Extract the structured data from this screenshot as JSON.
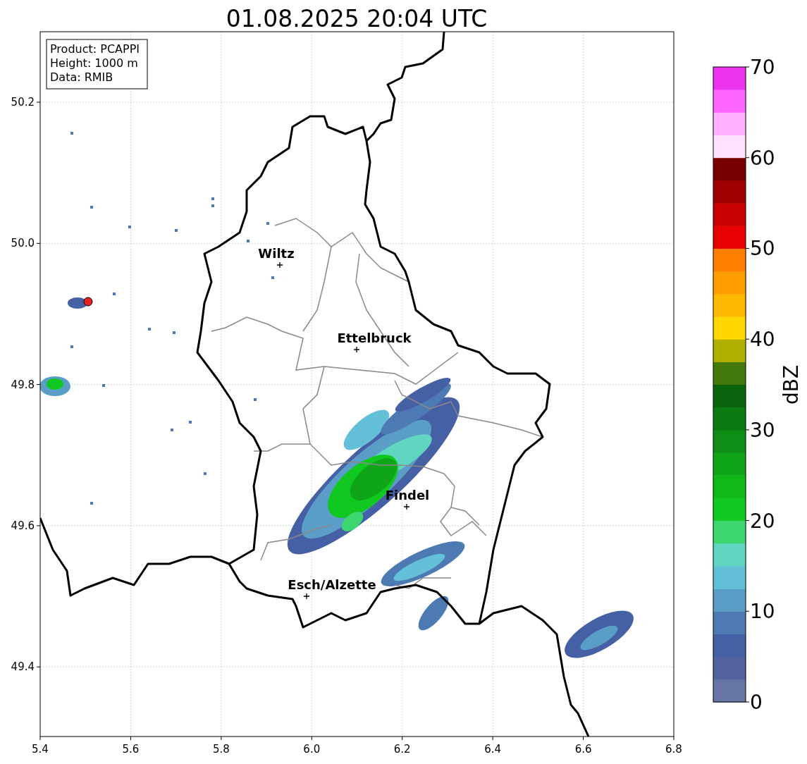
{
  "title": "01.08.2025 20:04 UTC",
  "info_box": [
    "Product: PCAPPI",
    "Height: 1000 m",
    "Data: RMIB"
  ],
  "cities": [
    {
      "name": "Wiltz"
    },
    {
      "name": "Ettelbruck"
    },
    {
      "name": "Findel"
    },
    {
      "name": "Esch/Alzette"
    }
  ],
  "x_axis": {
    "ticks": [
      "5.4",
      "5.6",
      "5.8",
      "6.0",
      "6.2",
      "6.4",
      "6.6",
      "6.8"
    ]
  },
  "y_axis": {
    "ticks": [
      "50.2",
      "50.0",
      "49.8",
      "49.6",
      "49.4"
    ]
  },
  "colorbar": {
    "label": "dBZ",
    "ticks": [
      "70",
      "60",
      "50",
      "40",
      "30",
      "20",
      "10",
      "0"
    ],
    "segments": [
      {
        "color": "#6674a6"
      },
      {
        "color": "#5463a0"
      },
      {
        "color": "#4660a6"
      },
      {
        "color": "#4d7ab3"
      },
      {
        "color": "#5a9ec8"
      },
      {
        "color": "#64c0d8"
      },
      {
        "color": "#60d6c0"
      },
      {
        "color": "#3ed670"
      },
      {
        "color": "#10c820"
      },
      {
        "color": "#10b818"
      },
      {
        "color": "#10a418"
      },
      {
        "color": "#0e8e14"
      },
      {
        "color": "#0b7a10"
      },
      {
        "color": "#0a640c"
      },
      {
        "color": "#447a0c"
      },
      {
        "color": "#b0b000"
      },
      {
        "color": "#ffd700"
      },
      {
        "color": "#ffb800"
      },
      {
        "color": "#ff9c00"
      },
      {
        "color": "#ff7f00"
      },
      {
        "color": "#e80000"
      },
      {
        "color": "#c80000"
      },
      {
        "color": "#a00000"
      },
      {
        "color": "#780000"
      },
      {
        "color": "#ffe0ff"
      },
      {
        "color": "#ffb0ff"
      },
      {
        "color": "#ff66ff"
      },
      {
        "color": "#ee33ee"
      }
    ]
  }
}
